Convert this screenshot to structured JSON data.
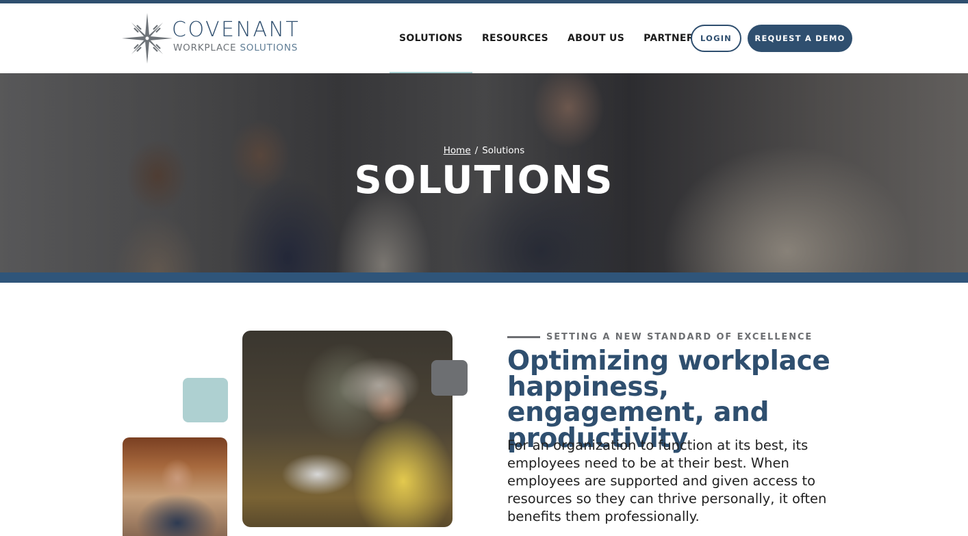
{
  "brand": {
    "name": "COVENANT",
    "tagline_primary": "WORKPLACE",
    "tagline_secondary": "SOLUTIONS",
    "colors": {
      "primary": "#2f4f6f",
      "accent_teal": "#aed0d1",
      "gray": "#6d6f72",
      "band": "#2f557a"
    }
  },
  "nav": {
    "items": [
      {
        "label": "SOLUTIONS",
        "active": true
      },
      {
        "label": "RESOURCES",
        "active": false
      },
      {
        "label": "ABOUT US",
        "active": false
      },
      {
        "label": "PARTNERS",
        "active": false
      }
    ],
    "login_label": "LOGIN",
    "demo_label": "REQUEST A DEMO"
  },
  "hero": {
    "breadcrumb": {
      "home": "Home",
      "separator": "/",
      "current": "Solutions"
    },
    "title": "SOLUTIONS"
  },
  "intro": {
    "eyebrow": "SETTING A NEW STANDARD OF EXCELLENCE",
    "headline": "Optimizing workplace happiness, engagement, and productivity",
    "body": "For an organization to function at its best, its employees need to be at their best. When employees are supported and given access to resources so they can thrive personally, it often benefits them professionally.",
    "images": {
      "woman": "woman-with-tablet-photo",
      "man": "man-with-tablet-photo"
    }
  }
}
